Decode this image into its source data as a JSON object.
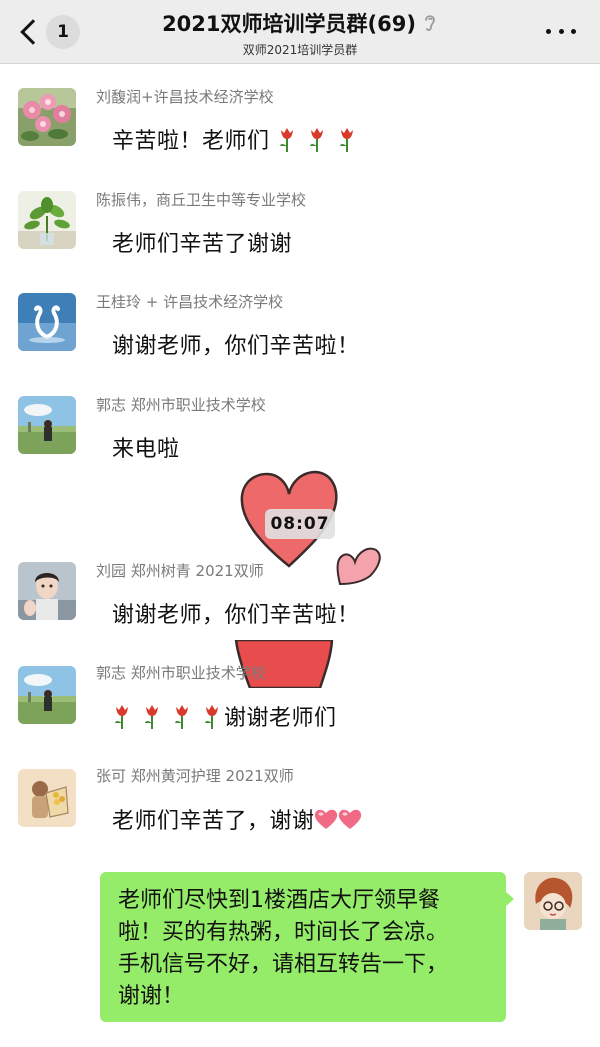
{
  "header": {
    "unread_count": "1",
    "title": "2021双师培训学员群(69)",
    "subtitle": "双师2021培训学员群"
  },
  "messages": [
    {
      "sender": "刘馥润+许昌技术经济学校",
      "text": "辛苦啦！老师们",
      "tulips": 3,
      "avatar": "flowers"
    },
    {
      "sender": "陈振伟，商丘卫生中等专业学校",
      "text": "老师们辛苦了谢谢",
      "avatar": "plant"
    },
    {
      "sender": "王桂玲 + 许昌技术经济学校",
      "text": "谢谢老师，你们辛苦啦！",
      "avatar": "swans"
    },
    {
      "sender": "郭志 郑州市职业技术学校",
      "text": "来电啦",
      "avatar": "field-person"
    },
    {
      "sender": "刘园 郑州树青 2021双师",
      "text": "谢谢老师，你们辛苦啦！",
      "avatar": "portrait"
    },
    {
      "sender": "郭志 郑州市职业技术学校",
      "text": "谢谢老师们",
      "tulips": 4,
      "avatar": "field-person"
    },
    {
      "sender": "张可  郑州黄河护理 2021双师",
      "text": "老师们辛苦了，谢谢",
      "hearts": 2,
      "avatar": "cartoon-bouquet"
    }
  ],
  "timestamp": "08:07",
  "my_message": {
    "text": "老师们尽快到1楼酒店大厅领早餐啦！买的有热粥，时间长了会凉。手机信号不好，请相互转告一下，谢谢！",
    "lines": [
      "老师们尽快到1楼酒店大厅领早餐",
      "啦！买的有热粥，时间长了会凉。",
      "手机信号不好，请相互转告一下，",
      "谢谢！"
    ],
    "avatar": "cartoon-girl"
  },
  "colors": {
    "header_bg": "#ededed",
    "my_bubble": "#95ec69",
    "sender_gray": "#7a7a7a",
    "heart_red": "#e85a5a",
    "tulip_red": "#d83a2c"
  },
  "icons": [
    "back-chevron-icon",
    "ear-icon",
    "more-icon",
    "tulip-icon",
    "heart-icon"
  ]
}
